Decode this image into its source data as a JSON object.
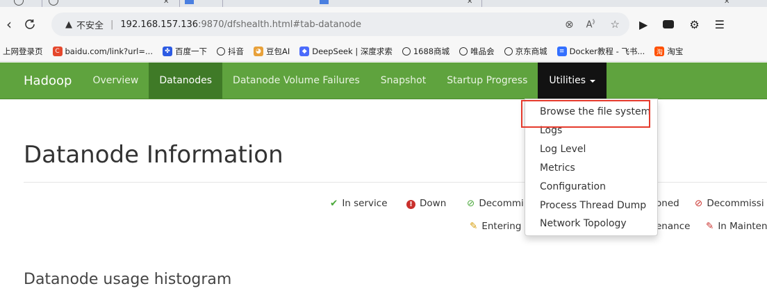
{
  "browser": {
    "security_warning": "不安全",
    "url_host": "192.168.157.136",
    "url_rest": ":9870/dfshealth.html#tab-datanode"
  },
  "bookmarks": [
    {
      "label": "上网登录页",
      "icon": "none"
    },
    {
      "label": "baidu.com/link?url=...",
      "icon": "c-logo-icon",
      "color": "#e5482d"
    },
    {
      "label": "百度一下",
      "icon": "baidu-paw-icon",
      "color": "#2d5be3"
    },
    {
      "label": "抖音",
      "icon": "globe-icon"
    },
    {
      "label": "豆包AI",
      "icon": "doubao-icon",
      "color": "#e8a13a"
    },
    {
      "label": "DeepSeek | 深度求索",
      "icon": "deepseek-whale-icon",
      "color": "#4b6bfb"
    },
    {
      "label": "1688商城",
      "icon": "globe-icon"
    },
    {
      "label": "唯品会",
      "icon": "globe-icon"
    },
    {
      "label": "京东商城",
      "icon": "globe-icon"
    },
    {
      "label": "Docker教程 - 飞书...",
      "icon": "feishu-doc-icon",
      "color": "#3370ff"
    },
    {
      "label": "淘宝",
      "icon": "taobao-icon",
      "color": "#ff5000"
    }
  ],
  "navbar": {
    "brand": "Hadoop",
    "items": [
      {
        "label": "Overview"
      },
      {
        "label": "Datanodes"
      },
      {
        "label": "Datanode Volume Failures"
      },
      {
        "label": "Snapshot"
      },
      {
        "label": "Startup Progress"
      },
      {
        "label": "Utilities"
      }
    ],
    "colors": {
      "bar": "#5fa33e",
      "active": "#3f7a27",
      "utilities": "#121212"
    }
  },
  "dropdown": {
    "items": [
      {
        "label": "Browse the file system"
      },
      {
        "label": "Logs"
      },
      {
        "label": "Log Level"
      },
      {
        "label": "Metrics"
      },
      {
        "label": "Configuration"
      },
      {
        "label": "Process Thread Dump"
      },
      {
        "label": "Network Topology"
      }
    ],
    "highlight_color": "#e53a2c"
  },
  "page": {
    "title": "Datanode Information",
    "subtitle": "Datanode usage histogram"
  },
  "legend": {
    "row1": [
      {
        "icon": "check-icon",
        "label": "In service",
        "color": "#4aa83a"
      },
      {
        "icon": "exclamation-circle-icon",
        "label": "Down",
        "color": "#c9302c"
      },
      {
        "icon": "ban-icon",
        "label": "Decommi",
        "color": "#4aa83a"
      },
      {
        "icon": "none",
        "label": "oned"
      },
      {
        "icon": "ban-icon",
        "label": "Decommissi",
        "color": "#c9302c"
      }
    ],
    "row2": [
      {
        "icon": "wrench-icon",
        "label": "Entering M",
        "color": "#d59a00"
      },
      {
        "icon": "none",
        "label": "enance"
      },
      {
        "icon": "wrench-icon",
        "label": "In Mainten",
        "color": "#c9302c"
      }
    ]
  }
}
